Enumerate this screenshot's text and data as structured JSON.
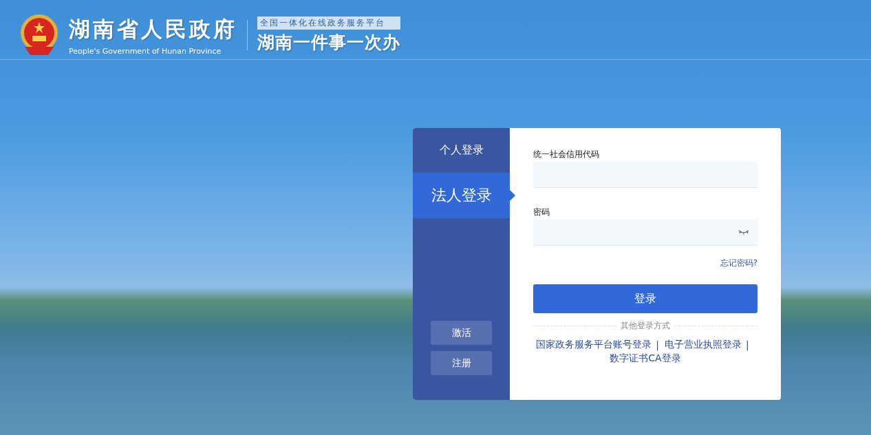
{
  "header": {
    "title": "湖南省人民政府",
    "subtitle": "People's Government of Hunan Province",
    "platform_tag": "全国一体化在线政务服务平台",
    "platform_name": "湖南一件事一次办"
  },
  "login": {
    "tabs": [
      {
        "label": "个人登录",
        "selected": false
      },
      {
        "label": "法人登录",
        "selected": true
      }
    ],
    "side_buttons": [
      "激活",
      "注册"
    ],
    "fields": [
      {
        "label": "统一社会信用代码",
        "kind": "text"
      },
      {
        "label": "密码",
        "kind": "password"
      }
    ],
    "forgot_link": "忘记密码?",
    "submit": "登录",
    "other_title": "其他登录方式",
    "other_links": [
      {
        "label": "国家政务服务平台账号登录",
        "separator": "|"
      },
      {
        "label": "电子营业执照登录",
        "separator": "|"
      },
      {
        "label": "数字证书CA登录"
      }
    ]
  }
}
